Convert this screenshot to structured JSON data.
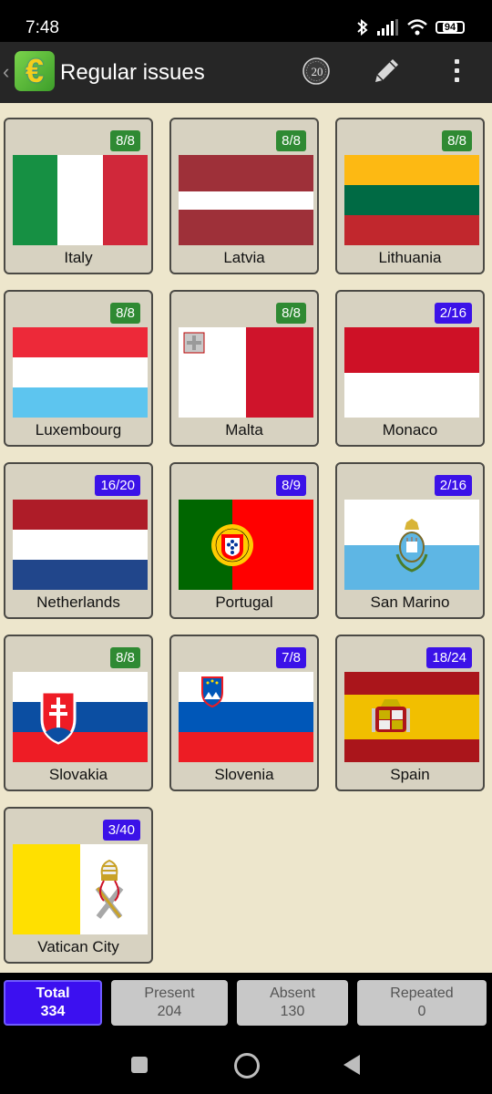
{
  "status": {
    "time": "7:48",
    "battery": "94"
  },
  "toolbar": {
    "title": "Regular issues",
    "logo_symbol": "€",
    "coin_label": "20"
  },
  "countries": [
    {
      "name": "Italy",
      "count": "8/8",
      "complete": true,
      "flag": "italy"
    },
    {
      "name": "Latvia",
      "count": "8/8",
      "complete": true,
      "flag": "latvia"
    },
    {
      "name": "Lithuania",
      "count": "8/8",
      "complete": true,
      "flag": "lithuania"
    },
    {
      "name": "Luxembourg",
      "count": "8/8",
      "complete": true,
      "flag": "luxembourg"
    },
    {
      "name": "Malta",
      "count": "8/8",
      "complete": true,
      "flag": "malta"
    },
    {
      "name": "Monaco",
      "count": "2/16",
      "complete": false,
      "flag": "monaco"
    },
    {
      "name": "Netherlands",
      "count": "16/20",
      "complete": false,
      "flag": "netherlands"
    },
    {
      "name": "Portugal",
      "count": "8/9",
      "complete": false,
      "flag": "portugal"
    },
    {
      "name": "San Marino",
      "count": "2/16",
      "complete": false,
      "flag": "san-marino"
    },
    {
      "name": "Slovakia",
      "count": "8/8",
      "complete": true,
      "flag": "slovakia"
    },
    {
      "name": "Slovenia",
      "count": "7/8",
      "complete": false,
      "flag": "slovenia"
    },
    {
      "name": "Spain",
      "count": "18/24",
      "complete": false,
      "flag": "spain"
    },
    {
      "name": "Vatican City",
      "count": "3/40",
      "complete": false,
      "flag": "vatican-city"
    }
  ],
  "summary": [
    {
      "label": "Total",
      "value": "334",
      "active": true
    },
    {
      "label": "Present",
      "value": "204",
      "active": false
    },
    {
      "label": "Absent",
      "value": "130",
      "active": false
    },
    {
      "label": "Repeated",
      "value": "0",
      "active": false
    }
  ],
  "colors": {
    "complete_badge": "#2f8a33",
    "partial_badge": "#3b12e8",
    "toolbar": "#262626",
    "background": "#ede6cc"
  }
}
